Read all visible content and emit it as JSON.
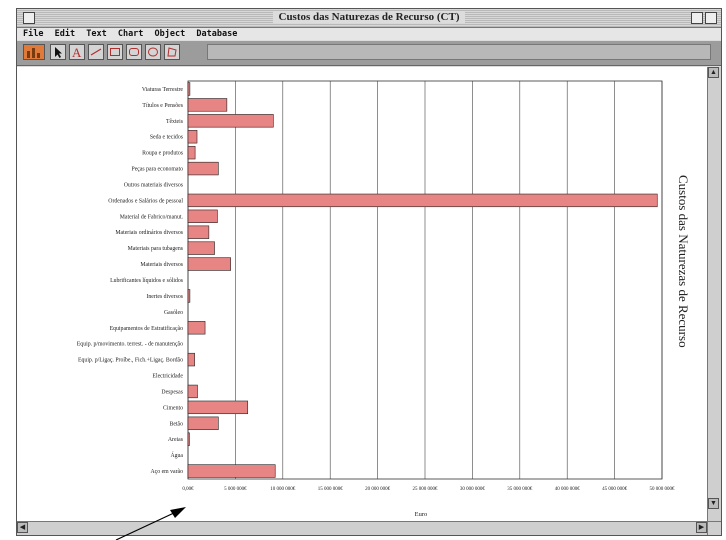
{
  "window": {
    "title": "Custos das Naturezas de Recurso (CT)",
    "menus": [
      "File",
      "Edit",
      "Text",
      "Chart",
      "Object",
      "Database"
    ]
  },
  "toolbar": {
    "tools": [
      {
        "icon": "bar-chart-icon",
        "selected": true
      },
      {
        "icon": "arrow-pointer-icon",
        "selected": false
      },
      {
        "icon": "text-tool-icon",
        "glyph": "A",
        "selected": false
      },
      {
        "icon": "line-tool-icon",
        "selected": false
      },
      {
        "icon": "rectangle-tool-icon",
        "selected": false
      },
      {
        "icon": "rounded-rect-tool-icon",
        "selected": false
      },
      {
        "icon": "oval-tool-icon",
        "selected": false
      },
      {
        "icon": "polygon-tool-icon",
        "selected": false
      }
    ]
  },
  "chart_data": {
    "type": "bar",
    "orientation": "horizontal",
    "title": "Custos das Naturezas de Recurso",
    "xlabel": "Euro",
    "ylabel": "",
    "xlim": [
      0,
      50000000
    ],
    "ticks": [
      "0,00€",
      "5 000 000€",
      "10 000 000€",
      "15 000 000€",
      "20 000 000€",
      "25 000 000€",
      "30 000 000€",
      "35 000 000€",
      "40 000 000€",
      "45 000 000€",
      "50 000 000€"
    ],
    "grid": true,
    "bar_color": "#e78585",
    "categories": [
      "Viaturas Terrestre",
      "Títulos e Pensões",
      "Têxteis",
      "Seda e tecidos",
      "Roupa e produtos",
      "Peças para economato",
      "Outros materiais diversos",
      "Ordenados e Salários de pessoal",
      "Material de Fabrico/manut.",
      "Materiais ordinários diversos",
      "Materiais para tubagens",
      "Materiais diversos",
      "Lubrificantes líquidos e sólidos",
      "Inertes diversos",
      "Gasóleo",
      "Equipamentos de Estratificação",
      "Equip. p/movimento. terrest. - de manutenção",
      "Equip. p/Ligaç. Proíbe., Fich.+Ligaç. Bordão",
      "Electricidade",
      "Despesas",
      "Cimento",
      "Betão",
      "Areias",
      "Água",
      "Aço em varão"
    ],
    "values": [
      200000,
      4100000,
      9000000,
      950000,
      750000,
      3200000,
      0,
      49500000,
      3100000,
      2200000,
      2800000,
      4500000,
      0,
      200000,
      0,
      1800000,
      0,
      700000,
      0,
      1000000,
      6300000,
      3200000,
      150000,
      0,
      9200000
    ]
  }
}
